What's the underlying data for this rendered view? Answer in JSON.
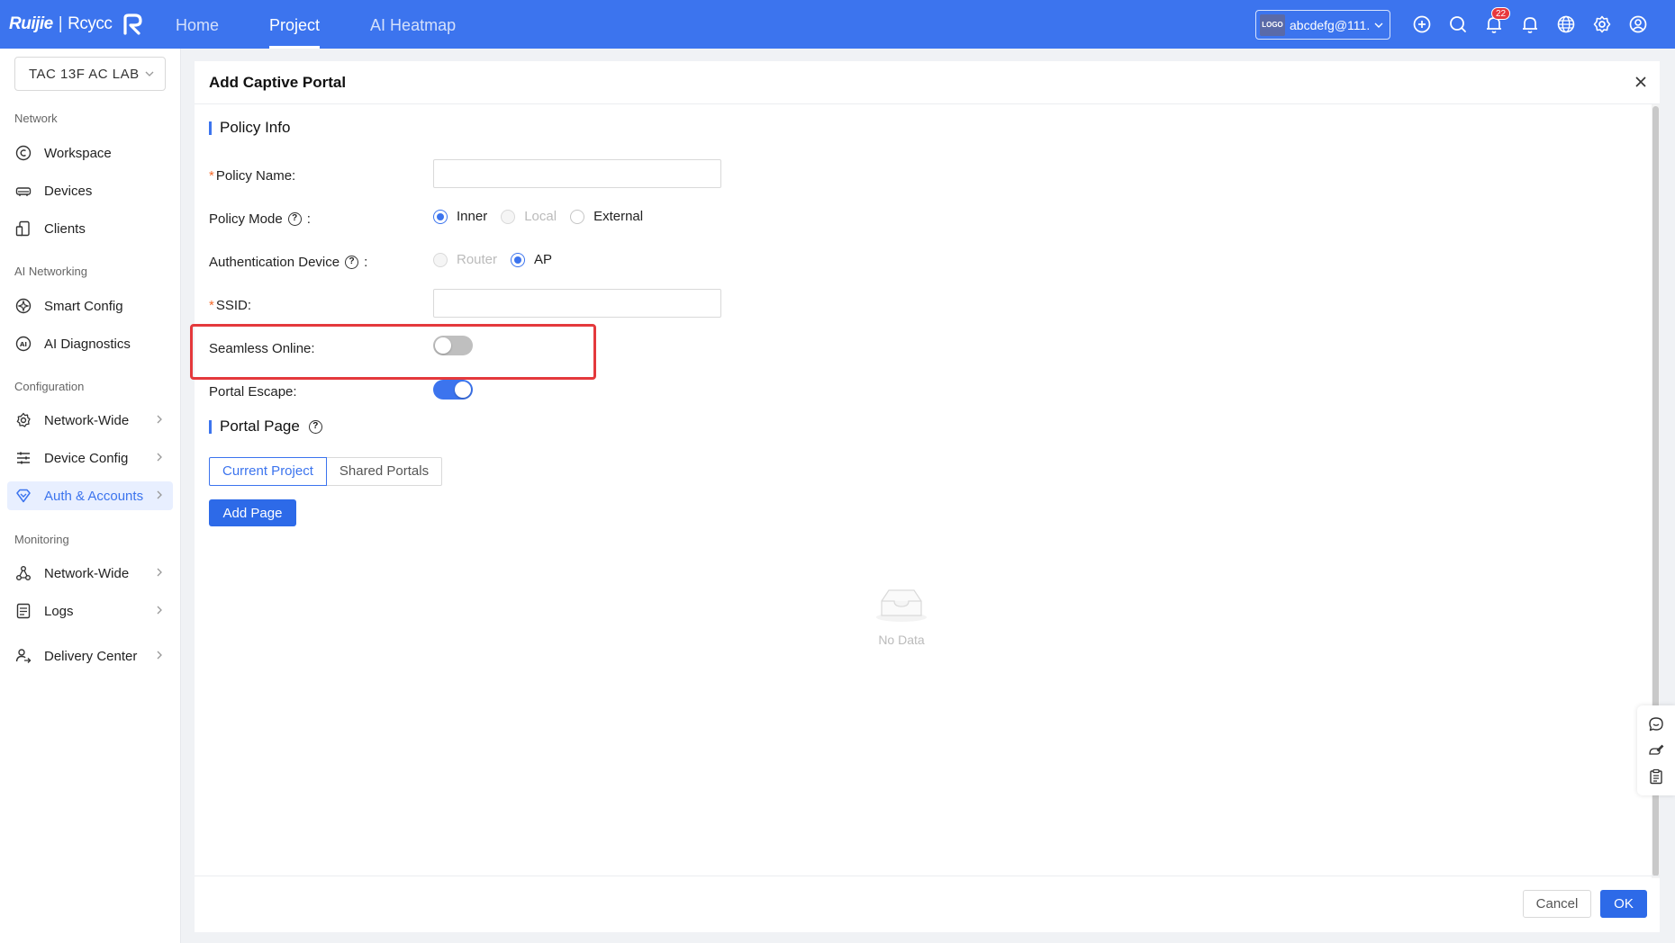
{
  "brand": {
    "name1": "Ruijie",
    "name2": "Rcycc"
  },
  "nav": {
    "items": [
      {
        "label": "Home"
      },
      {
        "label": "Project"
      },
      {
        "label": "AI Heatmap"
      }
    ]
  },
  "account": {
    "logo": "LOGO",
    "name": "abcdefg@111...."
  },
  "notifications": {
    "count": "22"
  },
  "sidebar": {
    "project": "TAC 13F AC LAB",
    "sections": [
      {
        "title": "Network",
        "items": [
          {
            "label": "Workspace"
          },
          {
            "label": "Devices"
          },
          {
            "label": "Clients"
          }
        ]
      },
      {
        "title": "AI Networking",
        "items": [
          {
            "label": "Smart Config"
          },
          {
            "label": "AI Diagnostics"
          }
        ]
      },
      {
        "title": "Configuration",
        "items": [
          {
            "label": "Network-Wide"
          },
          {
            "label": "Device Config"
          },
          {
            "label": "Auth & Accounts"
          }
        ]
      },
      {
        "title": "Monitoring",
        "items": [
          {
            "label": "Network-Wide"
          },
          {
            "label": "Logs"
          }
        ]
      }
    ],
    "delivery": "Delivery Center"
  },
  "modal": {
    "title": "Add Captive Portal",
    "policy_info": "Policy Info",
    "policy_name_label": "Policy Name",
    "policy_mode_label": "Policy Mode",
    "policy_mode_options": [
      "Inner",
      "Local",
      "External"
    ],
    "auth_device_label": "Authentication Device",
    "auth_device_options": [
      "Router",
      "AP"
    ],
    "ssid_label": "SSID",
    "seamless_label": "Seamless Online",
    "seamless_on": false,
    "escape_label": "Portal Escape",
    "escape_on": true,
    "portal_page": "Portal Page",
    "tabs": [
      "Current Project",
      "Shared Portals"
    ],
    "add_page": "Add Page",
    "empty_text": "No Data",
    "cancel": "Cancel",
    "ok": "OK"
  },
  "colors": {
    "primary": "#3c74ee",
    "highlight": "#e4393c",
    "required": "#f56c2d"
  }
}
